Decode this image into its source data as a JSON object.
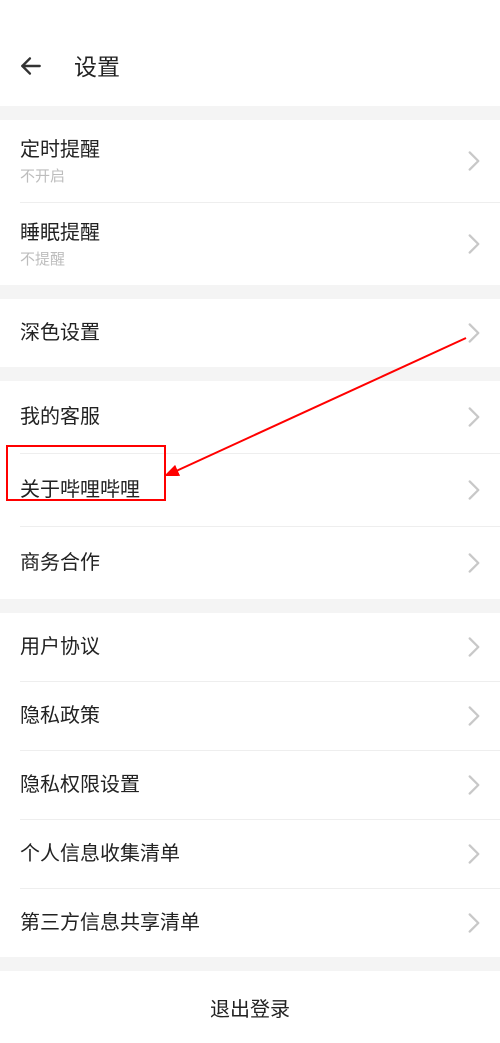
{
  "header": {
    "title": "设置"
  },
  "groups": [
    {
      "rows": [
        {
          "title": "定时提醒",
          "sub": "不开启"
        },
        {
          "title": "睡眠提醒",
          "sub": "不提醒"
        }
      ]
    },
    {
      "rows": [
        {
          "title": "深色设置"
        }
      ]
    },
    {
      "rows": [
        {
          "title": "我的客服"
        },
        {
          "title": "关于哔哩哔哩"
        },
        {
          "title": "商务合作"
        }
      ]
    },
    {
      "rows": [
        {
          "title": "用户协议"
        },
        {
          "title": "隐私政策"
        },
        {
          "title": "隐私权限设置"
        },
        {
          "title": "个人信息收集清单"
        },
        {
          "title": "第三方信息共享清单"
        }
      ]
    }
  ],
  "logout": "退出登录"
}
